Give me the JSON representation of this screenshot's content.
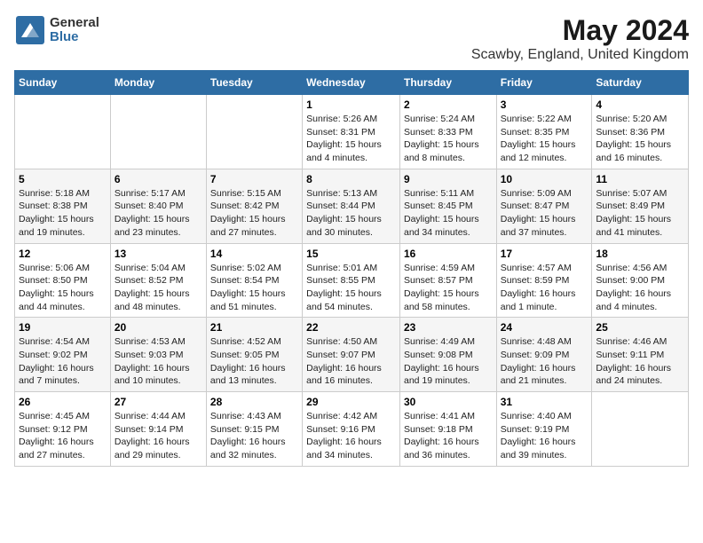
{
  "header": {
    "logo_general": "General",
    "logo_blue": "Blue",
    "title": "May 2024",
    "subtitle": "Scawby, England, United Kingdom"
  },
  "days_of_week": [
    "Sunday",
    "Monday",
    "Tuesday",
    "Wednesday",
    "Thursday",
    "Friday",
    "Saturday"
  ],
  "weeks": [
    [
      {
        "day": "",
        "info": ""
      },
      {
        "day": "",
        "info": ""
      },
      {
        "day": "",
        "info": ""
      },
      {
        "day": "1",
        "info": "Sunrise: 5:26 AM\nSunset: 8:31 PM\nDaylight: 15 hours and 4 minutes."
      },
      {
        "day": "2",
        "info": "Sunrise: 5:24 AM\nSunset: 8:33 PM\nDaylight: 15 hours and 8 minutes."
      },
      {
        "day": "3",
        "info": "Sunrise: 5:22 AM\nSunset: 8:35 PM\nDaylight: 15 hours and 12 minutes."
      },
      {
        "day": "4",
        "info": "Sunrise: 5:20 AM\nSunset: 8:36 PM\nDaylight: 15 hours and 16 minutes."
      }
    ],
    [
      {
        "day": "5",
        "info": "Sunrise: 5:18 AM\nSunset: 8:38 PM\nDaylight: 15 hours and 19 minutes."
      },
      {
        "day": "6",
        "info": "Sunrise: 5:17 AM\nSunset: 8:40 PM\nDaylight: 15 hours and 23 minutes."
      },
      {
        "day": "7",
        "info": "Sunrise: 5:15 AM\nSunset: 8:42 PM\nDaylight: 15 hours and 27 minutes."
      },
      {
        "day": "8",
        "info": "Sunrise: 5:13 AM\nSunset: 8:44 PM\nDaylight: 15 hours and 30 minutes."
      },
      {
        "day": "9",
        "info": "Sunrise: 5:11 AM\nSunset: 8:45 PM\nDaylight: 15 hours and 34 minutes."
      },
      {
        "day": "10",
        "info": "Sunrise: 5:09 AM\nSunset: 8:47 PM\nDaylight: 15 hours and 37 minutes."
      },
      {
        "day": "11",
        "info": "Sunrise: 5:07 AM\nSunset: 8:49 PM\nDaylight: 15 hours and 41 minutes."
      }
    ],
    [
      {
        "day": "12",
        "info": "Sunrise: 5:06 AM\nSunset: 8:50 PM\nDaylight: 15 hours and 44 minutes."
      },
      {
        "day": "13",
        "info": "Sunrise: 5:04 AM\nSunset: 8:52 PM\nDaylight: 15 hours and 48 minutes."
      },
      {
        "day": "14",
        "info": "Sunrise: 5:02 AM\nSunset: 8:54 PM\nDaylight: 15 hours and 51 minutes."
      },
      {
        "day": "15",
        "info": "Sunrise: 5:01 AM\nSunset: 8:55 PM\nDaylight: 15 hours and 54 minutes."
      },
      {
        "day": "16",
        "info": "Sunrise: 4:59 AM\nSunset: 8:57 PM\nDaylight: 15 hours and 58 minutes."
      },
      {
        "day": "17",
        "info": "Sunrise: 4:57 AM\nSunset: 8:59 PM\nDaylight: 16 hours and 1 minute."
      },
      {
        "day": "18",
        "info": "Sunrise: 4:56 AM\nSunset: 9:00 PM\nDaylight: 16 hours and 4 minutes."
      }
    ],
    [
      {
        "day": "19",
        "info": "Sunrise: 4:54 AM\nSunset: 9:02 PM\nDaylight: 16 hours and 7 minutes."
      },
      {
        "day": "20",
        "info": "Sunrise: 4:53 AM\nSunset: 9:03 PM\nDaylight: 16 hours and 10 minutes."
      },
      {
        "day": "21",
        "info": "Sunrise: 4:52 AM\nSunset: 9:05 PM\nDaylight: 16 hours and 13 minutes."
      },
      {
        "day": "22",
        "info": "Sunrise: 4:50 AM\nSunset: 9:07 PM\nDaylight: 16 hours and 16 minutes."
      },
      {
        "day": "23",
        "info": "Sunrise: 4:49 AM\nSunset: 9:08 PM\nDaylight: 16 hours and 19 minutes."
      },
      {
        "day": "24",
        "info": "Sunrise: 4:48 AM\nSunset: 9:09 PM\nDaylight: 16 hours and 21 minutes."
      },
      {
        "day": "25",
        "info": "Sunrise: 4:46 AM\nSunset: 9:11 PM\nDaylight: 16 hours and 24 minutes."
      }
    ],
    [
      {
        "day": "26",
        "info": "Sunrise: 4:45 AM\nSunset: 9:12 PM\nDaylight: 16 hours and 27 minutes."
      },
      {
        "day": "27",
        "info": "Sunrise: 4:44 AM\nSunset: 9:14 PM\nDaylight: 16 hours and 29 minutes."
      },
      {
        "day": "28",
        "info": "Sunrise: 4:43 AM\nSunset: 9:15 PM\nDaylight: 16 hours and 32 minutes."
      },
      {
        "day": "29",
        "info": "Sunrise: 4:42 AM\nSunset: 9:16 PM\nDaylight: 16 hours and 34 minutes."
      },
      {
        "day": "30",
        "info": "Sunrise: 4:41 AM\nSunset: 9:18 PM\nDaylight: 16 hours and 36 minutes."
      },
      {
        "day": "31",
        "info": "Sunrise: 4:40 AM\nSunset: 9:19 PM\nDaylight: 16 hours and 39 minutes."
      },
      {
        "day": "",
        "info": ""
      }
    ]
  ]
}
